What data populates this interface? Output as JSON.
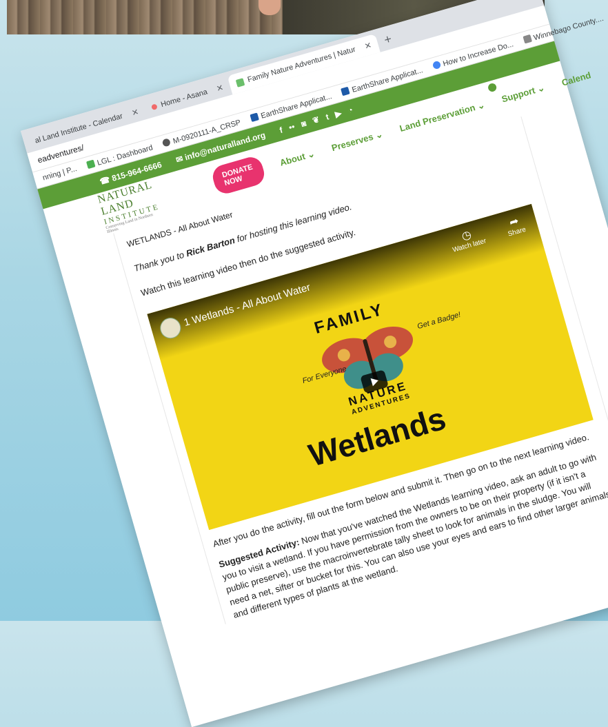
{
  "browser": {
    "tabs": [
      {
        "label": "al Land Institute - Calendar"
      },
      {
        "label": "Home - Asana"
      },
      {
        "label": "Family Nature Adventures | Natur"
      },
      {
        "label": "+"
      }
    ],
    "url": "eadventures/",
    "bookmarks": [
      "nning | P...",
      "LGL : Dashboard",
      "M-0920111-A_CRSP",
      "EarthShare Applicat...",
      "EarthShare Applicat...",
      "How to Increase Do...",
      "Winnebago County...."
    ]
  },
  "site": {
    "phone": "815-964-6666",
    "email": "info@naturalland.org",
    "logo_line1": "NATURAL LAND",
    "logo_line2": "INSTITUTE",
    "logo_tagline": "Conserving Land in Northern Illinois",
    "donate": "DONATE NOW",
    "nav": [
      "About",
      "Preserves",
      "Land Preservation",
      "Support",
      "Calend"
    ]
  },
  "content": {
    "heading": "WETLANDS - All About Water",
    "thanks_prefix": "Thank you to ",
    "thanks_name": "Rick Barton",
    "thanks_suffix": " for hosting this learning video.",
    "watch": "Watch this learning video then do the suggested activity.",
    "video": {
      "title": "1 Wetlands - All About Water",
      "watch_later": "Watch later",
      "share": "Share",
      "family": "FAMILY",
      "nature": "NATURE",
      "adventures": "ADVENTURES",
      "for_everyone": "For Everyone",
      "get_badge": "Get a Badge!",
      "wetlands": "Wetlands"
    },
    "after": "After you do the activity, fill out the form below and submit it. Then go on to the next learning video.",
    "suggested_label": "Suggested Activity:",
    "suggested_text": " Now that you've watched the Wetlands learning video, ask an adult to go with you to visit a wetland. If you have permission from the owners to be on their property (if it isn't a public preserve), use the macroinvertebrate tally sheet to look for animals in the sludge. You will need a net, sifter or bucket for this. You can also use your eyes and ears to find other larger animals and different types of plants at the wetland."
  }
}
